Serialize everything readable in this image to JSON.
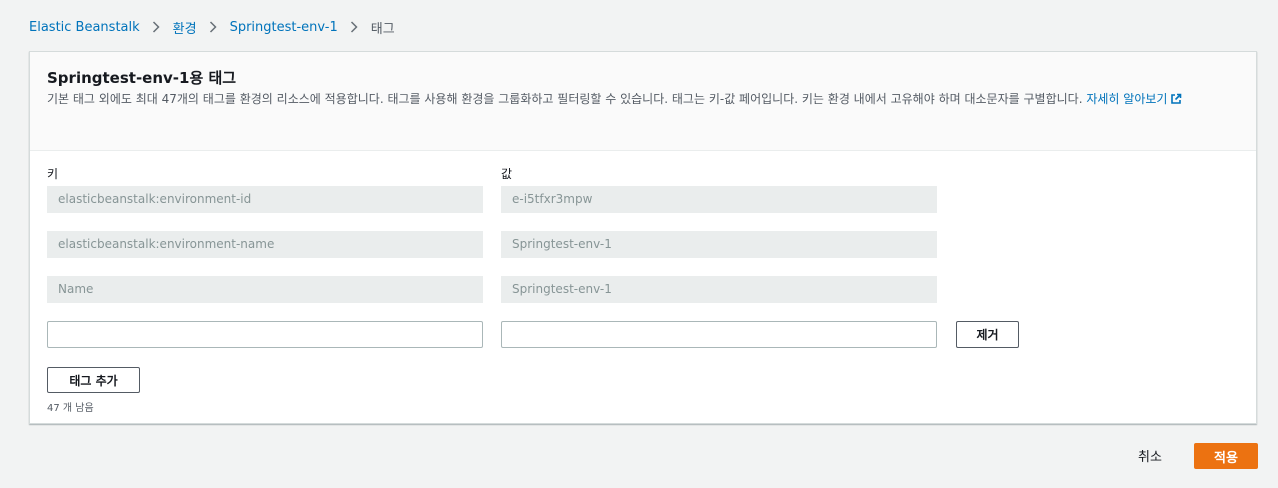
{
  "breadcrumb": {
    "items": [
      {
        "label": "Elastic Beanstalk"
      },
      {
        "label": "환경"
      },
      {
        "label": "Springtest-env-1"
      },
      {
        "label": "태그"
      }
    ]
  },
  "panel": {
    "title": "Springtest-env-1용 태그",
    "description": "기본 태그 외에도 최대 47개의 태그를 환경의 리소스에 적용합니다. 태그를 사용해 환경을 그룹화하고 필터링할 수 있습니다. 태그는 키-값 페어입니다. 키는 환경 내에서 고유해야 하며 대소문자를 구별합니다.",
    "learn_more_link": "자세히 알아보기",
    "learn_more_icon": "external-link-icon"
  },
  "columns": {
    "key_label": "키",
    "value_label": "값"
  },
  "tags": [
    {
      "key": "elasticbeanstalk:environment-id",
      "value": "e-i5tfxr3mpw"
    },
    {
      "key": "elasticbeanstalk:environment-name",
      "value": "Springtest-env-1"
    },
    {
      "key": "Name",
      "value": "Springtest-env-1"
    }
  ],
  "new_tag": {
    "key": "",
    "value": "",
    "remove_label": "제거"
  },
  "add_tag_label": "태그 추가",
  "remaining_text": "47 개 남음",
  "footer": {
    "cancel_label": "취소",
    "apply_label": "적용"
  },
  "colors": {
    "link": "#0073bb",
    "primary": "#ec7211",
    "background": "#f2f3f3"
  }
}
